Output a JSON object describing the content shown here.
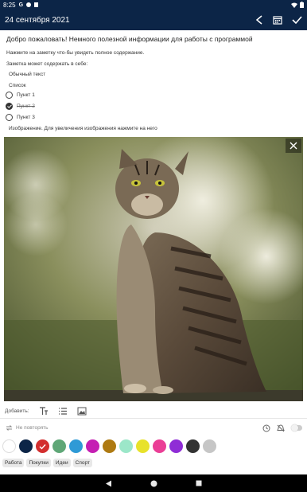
{
  "status": {
    "time": "8:25"
  },
  "appbar": {
    "title": "24 сентября 2021"
  },
  "note": {
    "title": "Добро пожаловать! Немного полезной информации для работы с программой",
    "lines": [
      "Нажмите на заметку что-бы увидеть полное содержание.",
      "Заметка может содержать в себе:",
      "Обычный текст",
      "Список"
    ],
    "checklist": [
      {
        "label": "Пункт 1",
        "checked": false
      },
      {
        "label": "Пункт 2",
        "checked": true
      },
      {
        "label": "Пункт 3",
        "checked": false
      }
    ],
    "image_hint": "Изображение. Для увеличения изображения нажмите на него"
  },
  "toolbar": {
    "add_label": "Добавить:"
  },
  "repeat": {
    "label": "Не повторять"
  },
  "colors": [
    "#ffffff",
    "#0c2547",
    "#d32f2f",
    "#5fa777",
    "#2f9ad6",
    "#c51fb3",
    "#ae7a12",
    "#9ce7c9",
    "#e8e22b",
    "#ea3e96",
    "#8f2dd6",
    "#333333",
    "#c6c6c6"
  ],
  "selected_color_index": 2,
  "tags": [
    "Работа",
    "Покупки",
    "Идеи",
    "Спорт"
  ]
}
